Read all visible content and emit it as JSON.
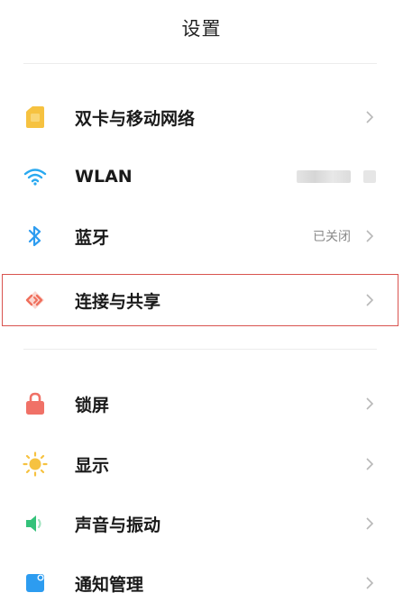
{
  "header": {
    "title": "设置"
  },
  "group1": [
    {
      "label": "双卡与移动网络",
      "icon": "sim-card-icon",
      "value": ""
    },
    {
      "label": "WLAN",
      "icon": "wifi-icon",
      "value": ""
    },
    {
      "label": "蓝牙",
      "icon": "bluetooth-icon",
      "value": "已关闭"
    },
    {
      "label": "连接与共享",
      "icon": "connection-sharing-icon",
      "value": ""
    }
  ],
  "group2": [
    {
      "label": "锁屏",
      "icon": "lock-icon",
      "value": ""
    },
    {
      "label": "显示",
      "icon": "sun-icon",
      "value": ""
    },
    {
      "label": "声音与振动",
      "icon": "speaker-icon",
      "value": ""
    },
    {
      "label": "通知管理",
      "icon": "notification-icon",
      "value": ""
    }
  ],
  "colors": {
    "sim": "#f6c240",
    "wifi": "#29a9f0",
    "bluetooth": "#2d9cf0",
    "connection": "#ef6f5c",
    "lock": "#f07167",
    "sun": "#f6c240",
    "speaker": "#34c27a",
    "notification": "#2d9cf0",
    "highlight_border": "#d9534f"
  }
}
